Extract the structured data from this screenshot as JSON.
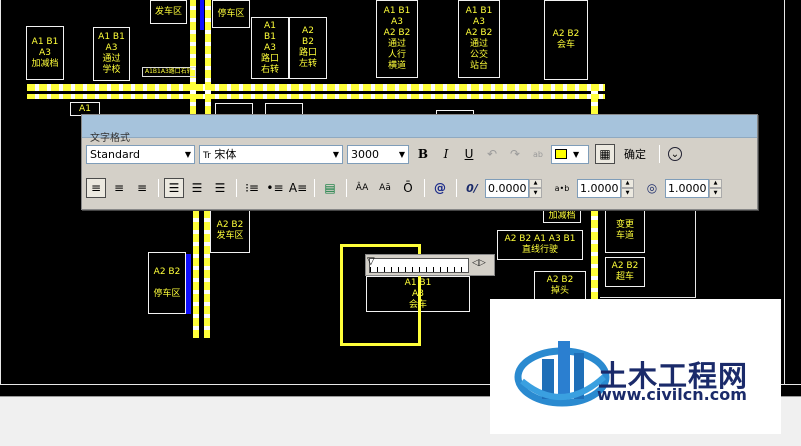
{
  "canvas_boxes": [
    {
      "text": "A1 B1\nA3\n加减档"
    },
    {
      "text": "A1 B1\nA3\n通过\n学校"
    },
    {
      "text": "发车区"
    },
    {
      "text": "停车区"
    },
    {
      "text": "A1\nB1\nA3\n路口\n右转"
    },
    {
      "text": "A2\nB2\n路口\n左转"
    },
    {
      "text": "A1 B1\nA3\nA2 B2\n通过\n人行\n横道"
    },
    {
      "text": "A1 B1\nA3\nA2 B2\n通过\n公交\n站台"
    },
    {
      "text": "A2 B2\n会车"
    },
    {
      "text": "A2 B2\n发车区"
    },
    {
      "text": "A2 B2\n\n停车区"
    },
    {
      "text": "A1 B1\nA3\n会车"
    },
    {
      "text": "A2 B2 A1 A3 B1\n直线行驶"
    },
    {
      "text": "A2 B2\n掉头"
    },
    {
      "text": "加减档"
    },
    {
      "text": "变更\n车道"
    },
    {
      "text": "A2 B2\n超车"
    },
    {
      "text": "A1"
    }
  ],
  "small_label": "A1B1A3路口右转",
  "toolbar": {
    "title": "文字格式",
    "style_select": "Standard",
    "font_select": "宋体",
    "font_prefix": "Tr",
    "height_select": "3000",
    "bold": "B",
    "italic": "I",
    "underline": "U",
    "undo": "↶",
    "redo": "↷",
    "stack": "ab",
    "ruler_btn": "▦",
    "ok_label": "确定",
    "options_icon": "⌄",
    "oblique_value": "0.0000",
    "tracking_value": "1.0000",
    "width_value": "1.0000",
    "tracking_icon": "a•b",
    "oblique_icon": "0/",
    "symbol_icon": "@",
    "field_icon": "▤",
    "upper_icon": "ÂA",
    "lower_icon": "Aā",
    "overline_icon": "Ō",
    "width_icon": "◎"
  },
  "ruler": {
    "marker": "▽",
    "arrows": "◁▷"
  },
  "watermark": {
    "brand": "土木工程网",
    "url": "www.civilcn.com"
  },
  "colors": {
    "cad_yellow": "#ffff3a",
    "toolbar_bg": "#d4d0c8",
    "titlebar": "#a6c3dc",
    "logo_blue": "#1a2a6a"
  }
}
